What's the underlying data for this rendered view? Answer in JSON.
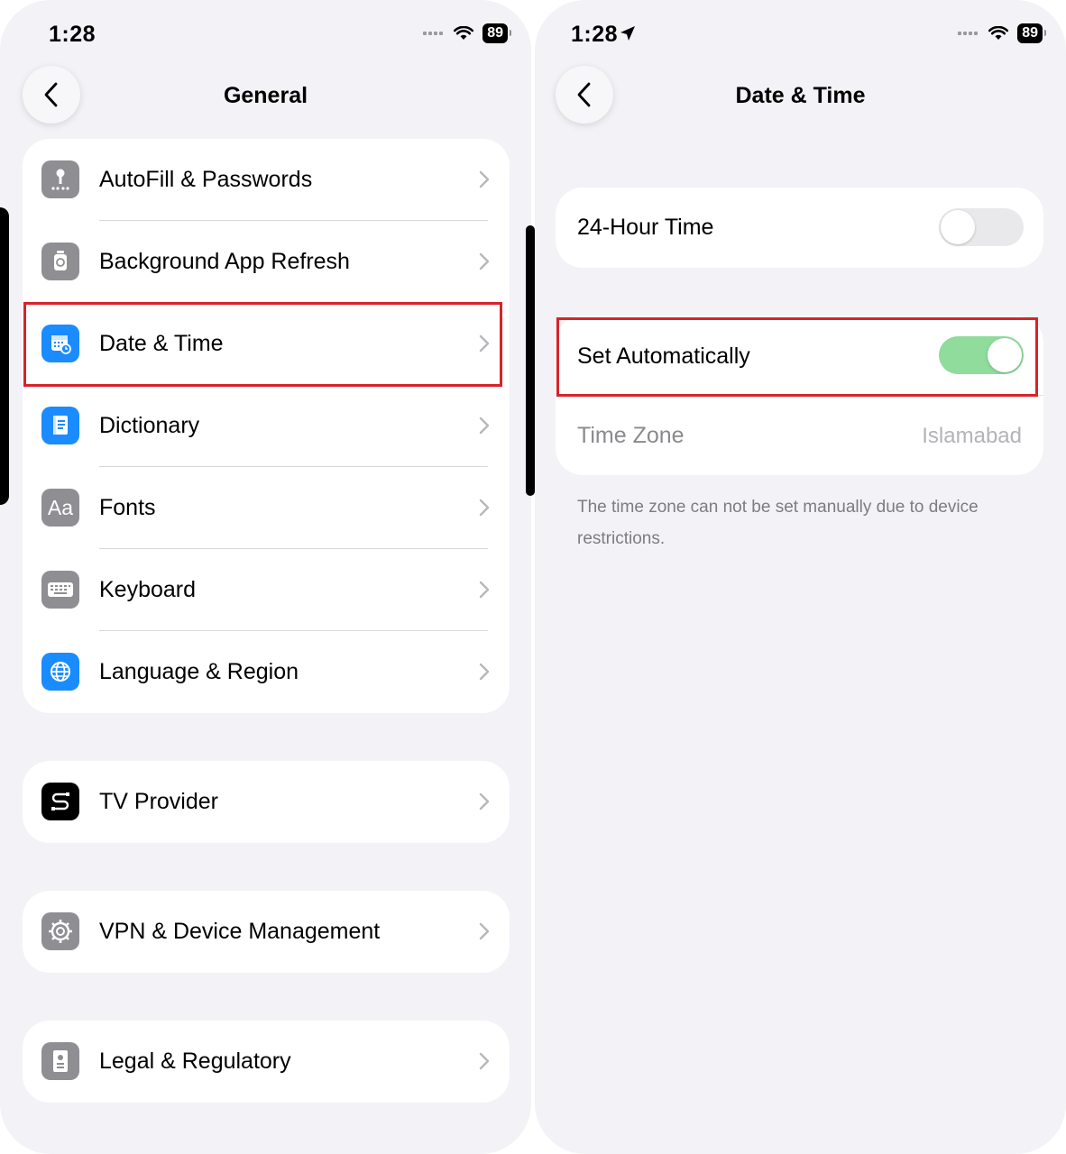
{
  "left": {
    "status_time": "1:28",
    "battery": "89",
    "title": "General",
    "group1": [
      {
        "label": "AutoFill & Passwords",
        "icon": "key-icon"
      },
      {
        "label": "Background App Refresh",
        "icon": "refresh-icon"
      },
      {
        "label": "Date & Time",
        "icon": "calendar-clock-icon"
      },
      {
        "label": "Dictionary",
        "icon": "book-icon"
      },
      {
        "label": "Fonts",
        "icon": "fonts-icon"
      },
      {
        "label": "Keyboard",
        "icon": "keyboard-icon"
      },
      {
        "label": "Language & Region",
        "icon": "globe-icon"
      }
    ],
    "tv_provider": "TV Provider",
    "vpn": "VPN & Device Management",
    "legal": "Legal & Regulatory",
    "fonts_icon_text": "Aa"
  },
  "right": {
    "status_time": "1:28",
    "battery": "89",
    "title": "Date & Time",
    "hour24_label": "24-Hour Time",
    "hour24_on": false,
    "set_auto_label": "Set Automatically",
    "set_auto_on": true,
    "timezone_label": "Time Zone",
    "timezone_value": "Islamabad",
    "footnote": "The time zone can not be set manually due to device restrictions."
  },
  "colors": {
    "background": "#f2f2f7",
    "highlight": "#d8232a",
    "toggle_on": "#8fdc9d",
    "toggle_off": "#e9e9eb"
  }
}
